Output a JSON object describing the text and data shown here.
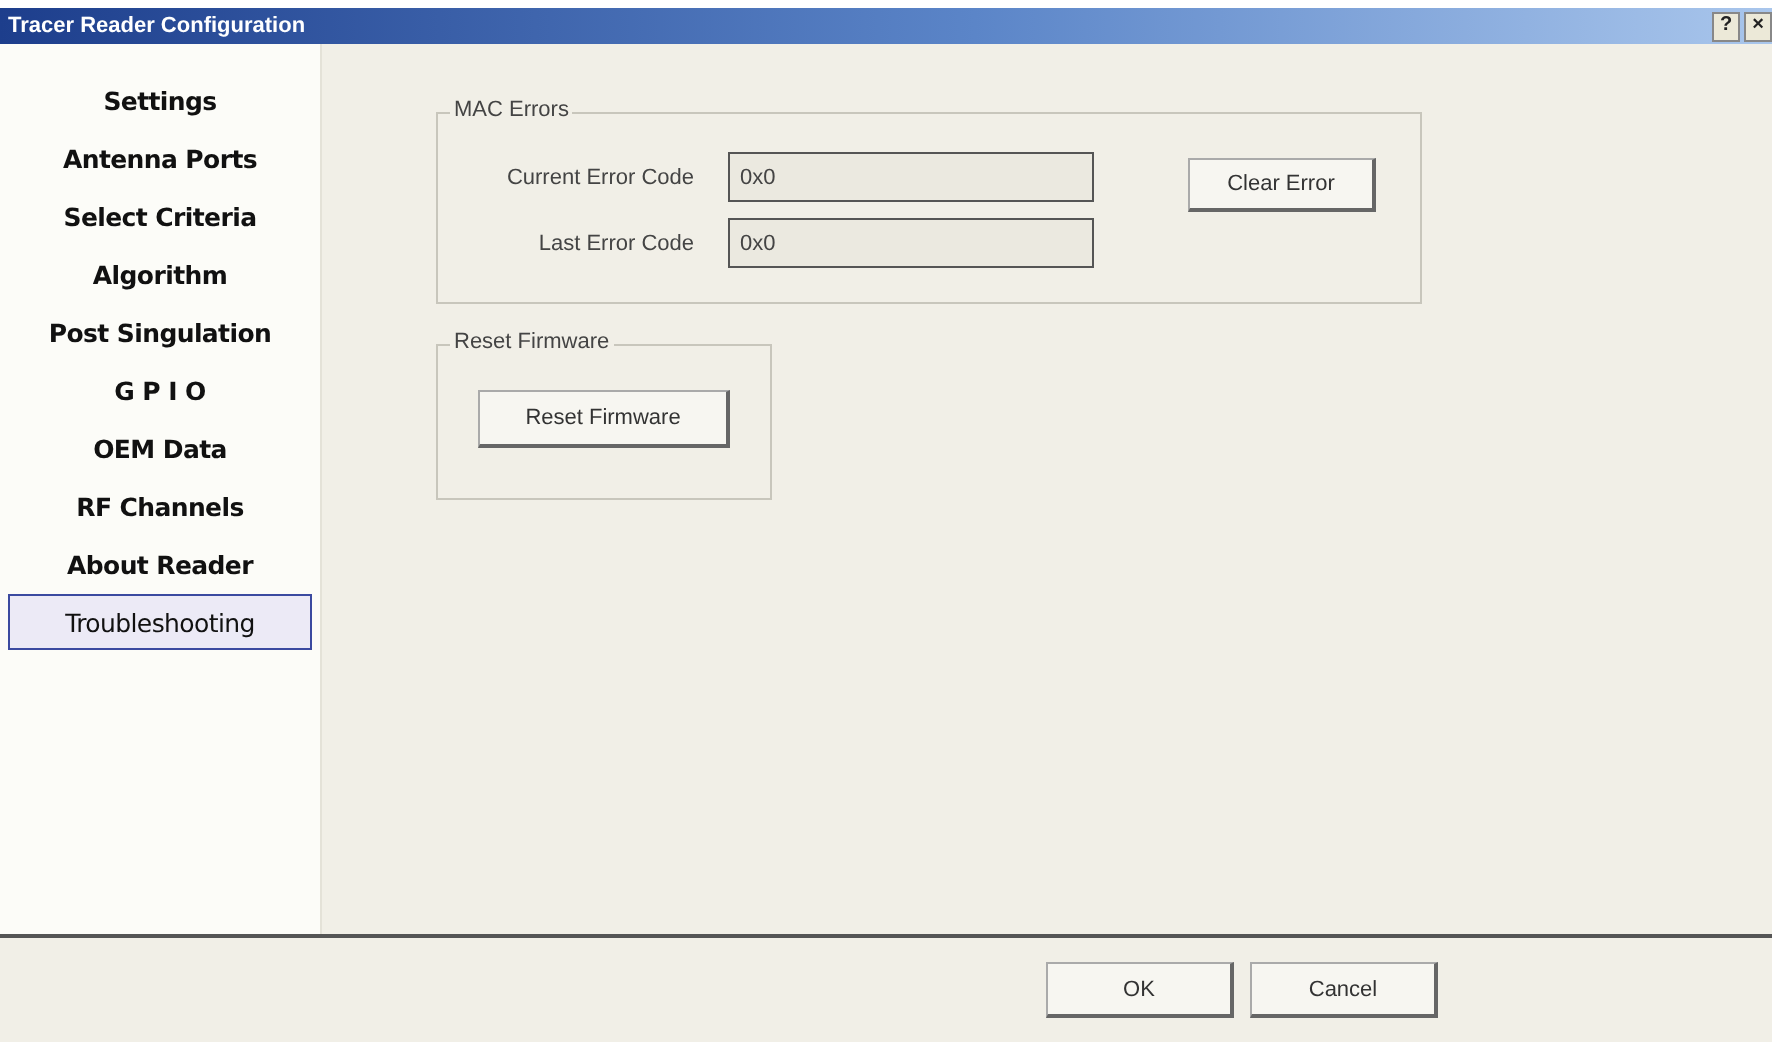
{
  "window": {
    "title": "Tracer Reader Configuration",
    "title_buttons": [
      "?",
      "×"
    ]
  },
  "sidebar": {
    "items": [
      {
        "label": "Settings",
        "selected": false
      },
      {
        "label": "Antenna Ports",
        "selected": false
      },
      {
        "label": "Select Criteria",
        "selected": false
      },
      {
        "label": "Algorithm",
        "selected": false
      },
      {
        "label": "Post Singulation",
        "selected": false
      },
      {
        "label": "G P I O",
        "selected": false
      },
      {
        "label": "OEM Data",
        "selected": false
      },
      {
        "label": "RF Channels",
        "selected": false
      },
      {
        "label": "About Reader",
        "selected": false
      },
      {
        "label": "Troubleshooting",
        "selected": true
      }
    ]
  },
  "mac_errors": {
    "title": "MAC Errors",
    "fields": [
      {
        "label": "Current Error Code",
        "value": "0x0"
      },
      {
        "label": "Last Error Code",
        "value": "0x0"
      }
    ],
    "button": "Clear Error"
  },
  "reset_firmware": {
    "title": "Reset Firmware",
    "button": "Reset Firmware"
  },
  "buttons": [
    "OK",
    "Cancel"
  ]
}
